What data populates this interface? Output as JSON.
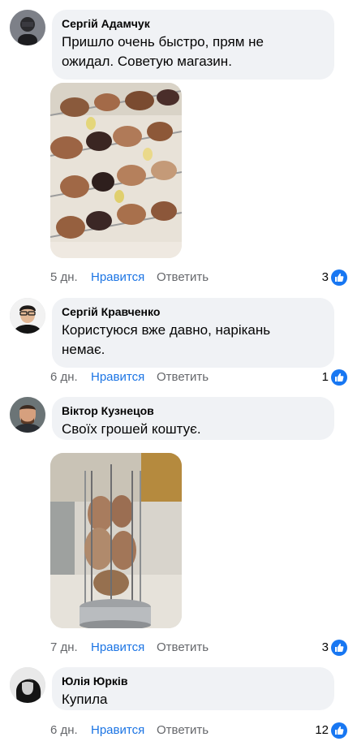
{
  "comments": [
    {
      "author": "Сергій Адамчук",
      "text_lines": [
        "Пришло очень быстро, прям не",
        "ожидал. Советую магазин."
      ],
      "time": "5 дн.",
      "like_label": "Нравится",
      "reply_label": "Ответить",
      "reaction_count": "3",
      "has_photo": true,
      "photo_subject": "skewers-with-meat-and-eggplant"
    },
    {
      "author": "Сергій Кравченко",
      "text_lines": [
        "Користуюся вже давно, нарікань",
        "немає."
      ],
      "time": "6 дн.",
      "like_label": "Нравится",
      "reply_label": "Ответить",
      "reaction_count": "1",
      "has_photo": false
    },
    {
      "author": "Віктор Кузнецов",
      "text_lines": [
        "Своїх грошей коштує."
      ],
      "time": "7 дн.",
      "like_label": "Нравится",
      "reply_label": "Ответить",
      "reaction_count": "3",
      "has_photo": true,
      "photo_subject": "vertical-electric-grill-with-meat"
    },
    {
      "author": "Юлія Юрків",
      "text_lines": [
        "Купила"
      ],
      "time": "6 дн.",
      "like_label": "Нравится",
      "reply_label": "Ответить",
      "reaction_count": "12",
      "has_photo": false
    }
  ],
  "colors": {
    "bubble": "#f0f2f5",
    "like_blue": "#1b74e4",
    "meta_gray": "#65676b",
    "reaction_blue": "#1877f2"
  },
  "icons": {
    "reaction": "thumbs-up-icon"
  }
}
